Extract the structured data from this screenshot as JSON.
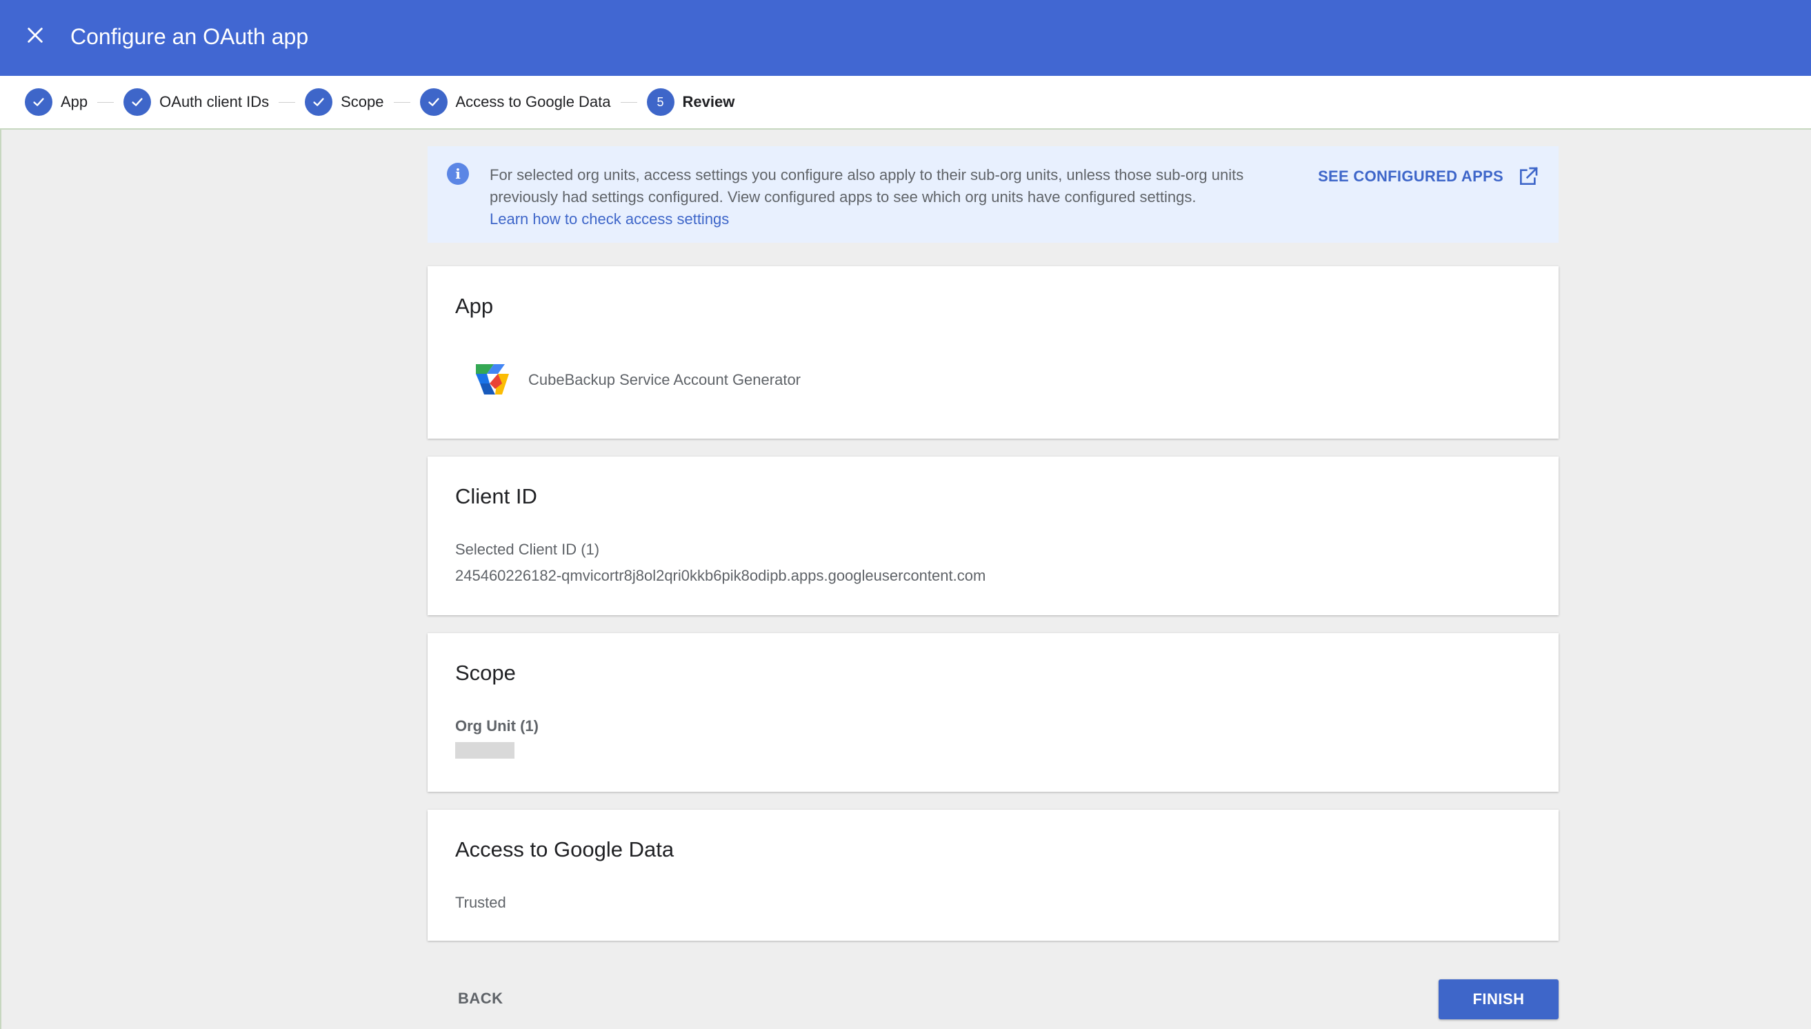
{
  "header": {
    "title": "Configure an OAuth app",
    "close_icon": "close-icon"
  },
  "stepper": {
    "steps": [
      {
        "label": "App",
        "status": "complete"
      },
      {
        "label": "OAuth client IDs",
        "status": "complete"
      },
      {
        "label": "Scope",
        "status": "complete"
      },
      {
        "label": "Access to Google Data",
        "status": "complete"
      },
      {
        "label": "Review",
        "status": "active",
        "number": "5"
      }
    ]
  },
  "banner": {
    "text": "For selected org units, access settings you configure also apply to their sub-org units, unless those sub-org units previously had settings configured. View configured apps to see which org units have configured settings.",
    "link": "Learn how to check access settings",
    "action": "SEE CONFIGURED APPS",
    "action_icon": "open-in-new-icon"
  },
  "app_card": {
    "title": "App",
    "app_name": "CubeBackup Service Account Generator",
    "logo_icon": "cubebackup-logo-icon"
  },
  "client_card": {
    "title": "Client ID",
    "label": "Selected Client ID (1)",
    "value": "245460226182-qmvicortr8j8ol2qri0kkb6pik8odipb.apps.googleusercontent.com"
  },
  "scope_card": {
    "title": "Scope",
    "label": "Org Unit (1)"
  },
  "access_card": {
    "title": "Access to Google Data",
    "value": "Trusted"
  },
  "footer": {
    "back_label": "BACK",
    "finish_label": "FINISH"
  },
  "colors": {
    "header": "#4167d2",
    "accent": "#3e66c9",
    "banner_bg": "#e8f0fe",
    "page_bg": "#eeeeee"
  }
}
